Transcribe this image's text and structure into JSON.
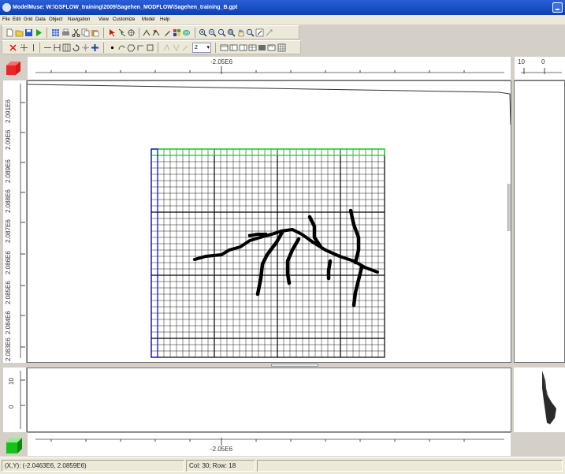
{
  "window": {
    "title": "ModelMuse: W:\\GSFLOW_training\\2009\\Sagehen_MODFLOW\\Sagehen_training_B.gpt"
  },
  "menu": [
    "File",
    "Edit",
    "Grid",
    "Data",
    "Object",
    "Navigation",
    "View",
    "Customize",
    "Model",
    "Help"
  ],
  "toolbar": {
    "layer_value": "2"
  },
  "top_view": {
    "x_axis_label": "-2.05E6",
    "y_tick_labels": [
      "2.091E6",
      "2.09E6",
      "2.089E6",
      "2.088E6",
      "2.087E6",
      "2.086E6",
      "2.085E6",
      "2.084E6",
      "2.083E6"
    ]
  },
  "side_view": {
    "x_ruler_labels": [
      "10",
      "0"
    ]
  },
  "front_view": {
    "z_tick_labels": [
      "10",
      "0"
    ],
    "x_axis_label": "-2.05E6"
  },
  "status": {
    "cursor_coords": "(X,Y): (-2.0463E6, 2.0859E6)",
    "cell_location": "Col: 30; Row: 18"
  },
  "colors": {
    "grid_lines": "#000000",
    "top_row_highlight": "#00dd00",
    "left_column_highlight": "#0000cc",
    "stream_features": "#000000"
  }
}
